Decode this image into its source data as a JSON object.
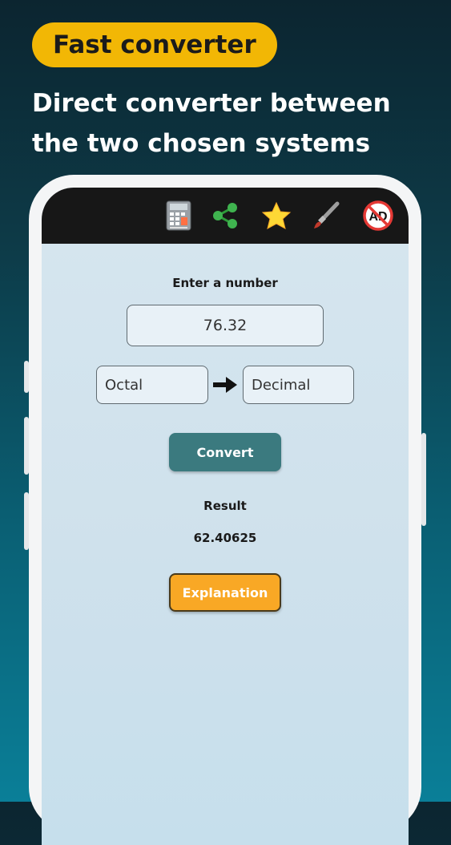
{
  "promo": {
    "badge": "Fast converter",
    "headline_line1": "Direct converter between",
    "headline_line2": "the two chosen systems"
  },
  "toolbar": {
    "icons": [
      "calculator-icon",
      "share-icon",
      "star-icon",
      "paintbrush-icon",
      "no-ads-icon"
    ],
    "no_ads_text": "AD"
  },
  "app": {
    "input_label": "Enter a number",
    "input_value": "76.32",
    "from_system": "Octal",
    "to_system": "Decimal",
    "convert_label": "Convert",
    "result_label": "Result",
    "result_value": "62.40625",
    "explanation_label": "Explanation"
  },
  "colors": {
    "badge": "#f2b705",
    "convert_button": "#3b7a7f",
    "explanation_button": "#f9a825"
  }
}
